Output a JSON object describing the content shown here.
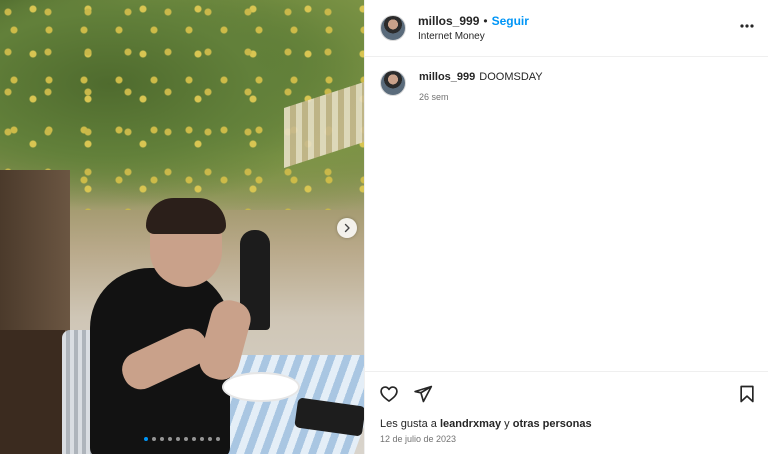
{
  "post": {
    "username": "millos_999",
    "separator": "•",
    "follow_label": "Seguir",
    "subtitle": "Internet Money",
    "caption_username": "millos_999",
    "caption_text": "DOOMSDAY",
    "caption_time": "26 sem",
    "likes_prefix": "Les gusta a",
    "likes_user": "leandrxmay",
    "likes_connector": "y",
    "likes_others": "otras personas",
    "date": "12 de julio de 2023",
    "carousel": {
      "total": 10,
      "current": 1
    }
  },
  "icons": {
    "more": "more-horizontal-icon",
    "like": "heart-icon",
    "share": "send-icon",
    "save": "bookmark-icon",
    "next": "chevron-right-icon"
  },
  "colors": {
    "accent": "#0095f6",
    "text": "#262626",
    "muted": "#737373",
    "border": "#efefef"
  }
}
